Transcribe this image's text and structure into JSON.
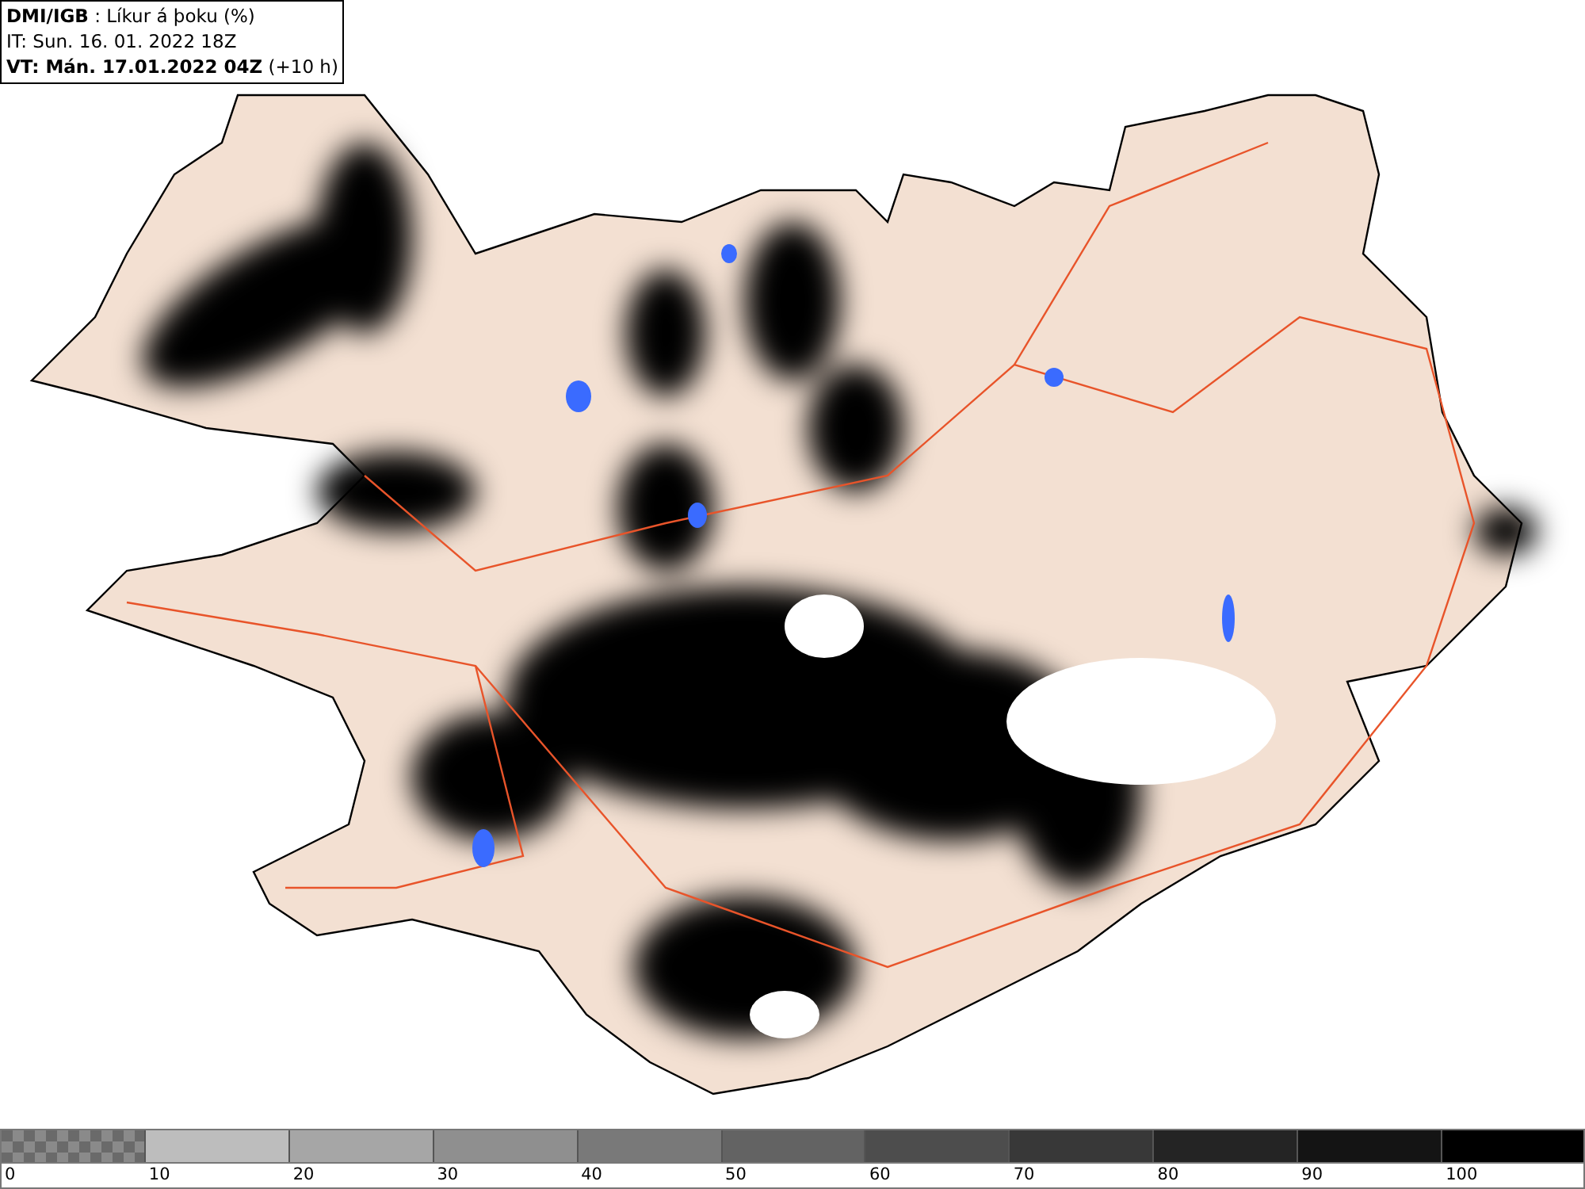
{
  "info_box": {
    "lines": [
      "**DMI/IGB** : Líkur á þoku (%)",
      "IT: Sun. 16. 01. 2022 18Z",
      "**VT: Mán. 17.01.2022 04Z** (+10 h)"
    ]
  },
  "legend": {
    "swatches": [
      {
        "kind": "pattern",
        "color": "#6a6a6a",
        "label": "0"
      },
      {
        "kind": "solid",
        "color": "#bdbdbd",
        "label": "10"
      },
      {
        "kind": "solid",
        "color": "#a6a6a6",
        "label": "20"
      },
      {
        "kind": "solid",
        "color": "#8f8f8f",
        "label": "30"
      },
      {
        "kind": "solid",
        "color": "#797979",
        "label": "40"
      },
      {
        "kind": "solid",
        "color": "#636363",
        "label": "50"
      },
      {
        "kind": "solid",
        "color": "#4d4d4d",
        "label": "60"
      },
      {
        "kind": "solid",
        "color": "#383838",
        "label": "70"
      },
      {
        "kind": "solid",
        "color": "#242424",
        "label": "80"
      },
      {
        "kind": "solid",
        "color": "#141414",
        "label": "90"
      },
      {
        "kind": "solid",
        "color": "#000000",
        "label": "100"
      }
    ]
  }
}
